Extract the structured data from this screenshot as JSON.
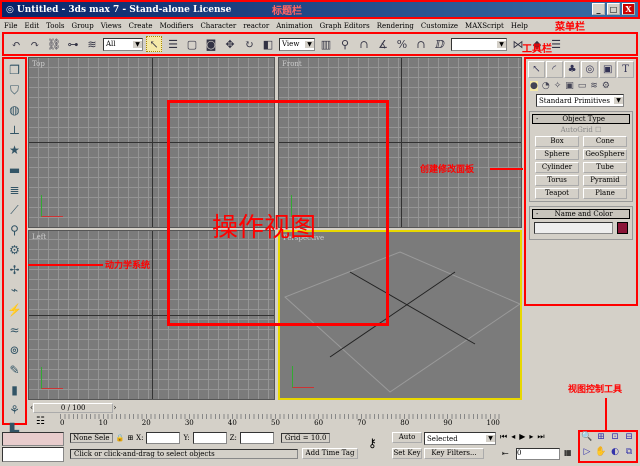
{
  "title": "Untitled - 3ds max 7 - Stand-alone License",
  "window_buttons": [
    "_",
    "□",
    "X"
  ],
  "menu": [
    "File",
    "Edit",
    "Tools",
    "Group",
    "Views",
    "Create",
    "Modifiers",
    "Character",
    "reactor",
    "Animation",
    "Graph Editors",
    "Rendering",
    "Customize",
    "MAXScript",
    "Help"
  ],
  "toolbar": {
    "selection_filter": "All",
    "ref_coord": "View",
    "named_sel": ""
  },
  "viewports": [
    "Top",
    "Front",
    "Left",
    "Perspective"
  ],
  "panel": {
    "category": "Standard Primitives",
    "object_type": "Object Type",
    "autogrid": "AutoGrid",
    "buttons": [
      "Box",
      "Cone",
      "Sphere",
      "GeoSphere",
      "Cylinder",
      "Tube",
      "Torus",
      "Pyramid",
      "Teapot",
      "Plane"
    ],
    "name_color": "Name and Color",
    "color": "#8b1538"
  },
  "timeline": {
    "slider": "0 / 100",
    "ticks": [
      "0",
      "10",
      "20",
      "30",
      "40",
      "50",
      "60",
      "70",
      "80",
      "90",
      "100"
    ]
  },
  "status": {
    "selection": "None Sele",
    "x": "X:",
    "y": "Y:",
    "z": "Z:",
    "grid": "Grid = 10.0",
    "prompt": "Click or click-and-drag to select objects",
    "add_time_tag": "Add Time Tag",
    "auto_key": "Auto Key",
    "set_key": "Set Key",
    "key_mode": "Selected",
    "key_filters": "Key Filters...",
    "frame": "0"
  },
  "annotations": {
    "title_bar": "标题栏",
    "menu_bar": "菜单栏",
    "toolbar": "工具栏",
    "create_panel": "创建修改面板",
    "viewport": "操作视图",
    "dynamics": "动力学系统",
    "view_controls": "视图控制工具"
  }
}
